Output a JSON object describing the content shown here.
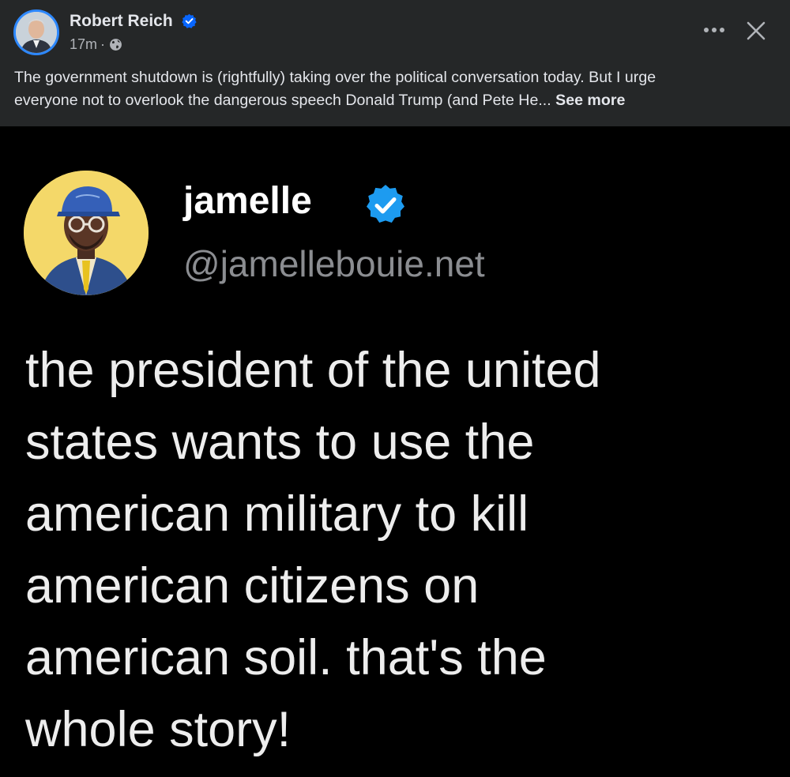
{
  "post": {
    "author_name": "Robert Reich",
    "time": "17m",
    "separator": "·",
    "audience_icon": "globe-icon",
    "text_lines": [
      "The government shutdown is (rightfully) taking over the political conversation today. But I urge",
      "everyone not to overlook the dangerous speech Donald Trump (and Pete He..."
    ],
    "see_more": "See more",
    "more_icon": "more-horizontal-icon",
    "close_icon": "close-icon"
  },
  "tweet": {
    "display_name": "jamelle",
    "handle": "@jamellebouie.net",
    "text_lines": [
      "the president of the united",
      "states wants to use the",
      "american military to kill",
      "american citizens on",
      "american soil. that's the",
      "whole story!"
    ]
  },
  "colors": {
    "header_bg": "#252728",
    "tweet_bg": "#000000",
    "verified_blue": "#1d9bf0",
    "fb_verified_blue": "#0866ff",
    "primary_text": "#e4e6eb",
    "secondary_text": "#b0b3b8",
    "handle_gray": "#8b8d91"
  }
}
